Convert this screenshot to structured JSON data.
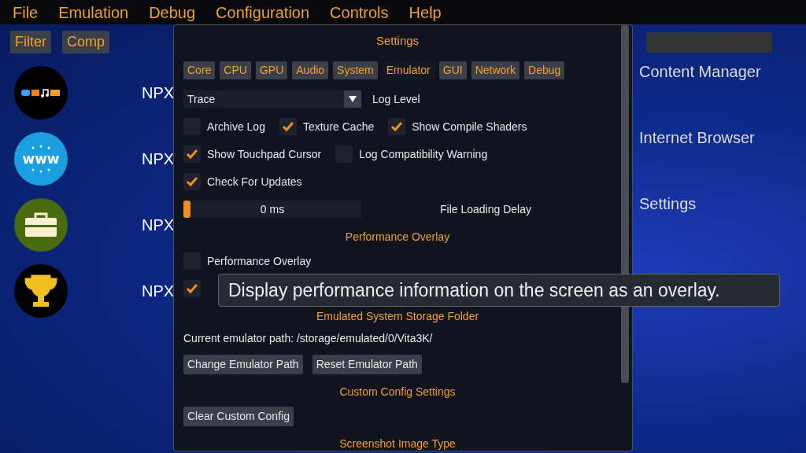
{
  "menu": [
    "File",
    "Emulation",
    "Debug",
    "Configuration",
    "Controls",
    "Help"
  ],
  "header_buttons": [
    "Filter",
    "Comp"
  ],
  "apps": [
    {
      "title_id": "NPX",
      "name": "Content Manager"
    },
    {
      "icon_text": "www",
      "title_id": "NPX",
      "name": "Internet Browser"
    },
    {
      "title_id": "NPX",
      "name": "Settings"
    },
    {
      "title_id": "NPX"
    }
  ],
  "settings": {
    "title": "Settings",
    "tabs": [
      {
        "label": "Core",
        "selected": false
      },
      {
        "label": "CPU",
        "selected": false
      },
      {
        "label": "GPU",
        "selected": false
      },
      {
        "label": "Audio",
        "selected": false
      },
      {
        "label": "System",
        "selected": false
      },
      {
        "label": "Emulator",
        "selected": true
      },
      {
        "label": "GUI",
        "selected": false
      },
      {
        "label": "Network",
        "selected": false
      },
      {
        "label": "Debug",
        "selected": false
      }
    ],
    "items": [
      {
        "kind": "dropdown",
        "value": "Trace",
        "label": "Log Level"
      },
      {
        "kind": "checks",
        "checks": [
          {
            "label": "Archive Log",
            "checked": false
          },
          {
            "label": "Texture Cache",
            "checked": true
          },
          {
            "label": "Show Compile Shaders",
            "checked": true
          }
        ]
      },
      {
        "kind": "checks",
        "checks": [
          {
            "label": "Show Touchpad Cursor",
            "checked": true
          },
          {
            "label": "Log Compatibility Warning",
            "checked": false
          }
        ]
      },
      {
        "kind": "checks",
        "checks": [
          {
            "label": "Check For Updates",
            "checked": true
          }
        ]
      },
      {
        "kind": "slider",
        "level": 0,
        "reading": "0 ms",
        "label": "File Loading Delay"
      },
      {
        "kind": "heading",
        "text": "Performance Overlay"
      },
      {
        "kind": "checks",
        "checks": [
          {
            "label": "Performance Overlay",
            "checked": false
          }
        ]
      },
      {
        "kind": "checks",
        "checks": [
          {
            "checked": true
          }
        ]
      },
      {
        "kind": "heading",
        "text": "Emulated System Storage Folder"
      },
      {
        "kind": "text",
        "text": "Current emulator path: /storage/emulated/0/Vita3K/"
      },
      {
        "kind": "buttons",
        "buttons": [
          "Change Emulator Path",
          "Reset Emulator Path"
        ]
      },
      {
        "kind": "heading",
        "text": "Custom Config Settings"
      },
      {
        "kind": "buttons",
        "buttons": [
          "Clear Custom Config"
        ]
      },
      {
        "kind": "heading",
        "text": "Screenshot Image Type"
      }
    ]
  },
  "tooltip": "Display performance information on the screen as an overlay."
}
